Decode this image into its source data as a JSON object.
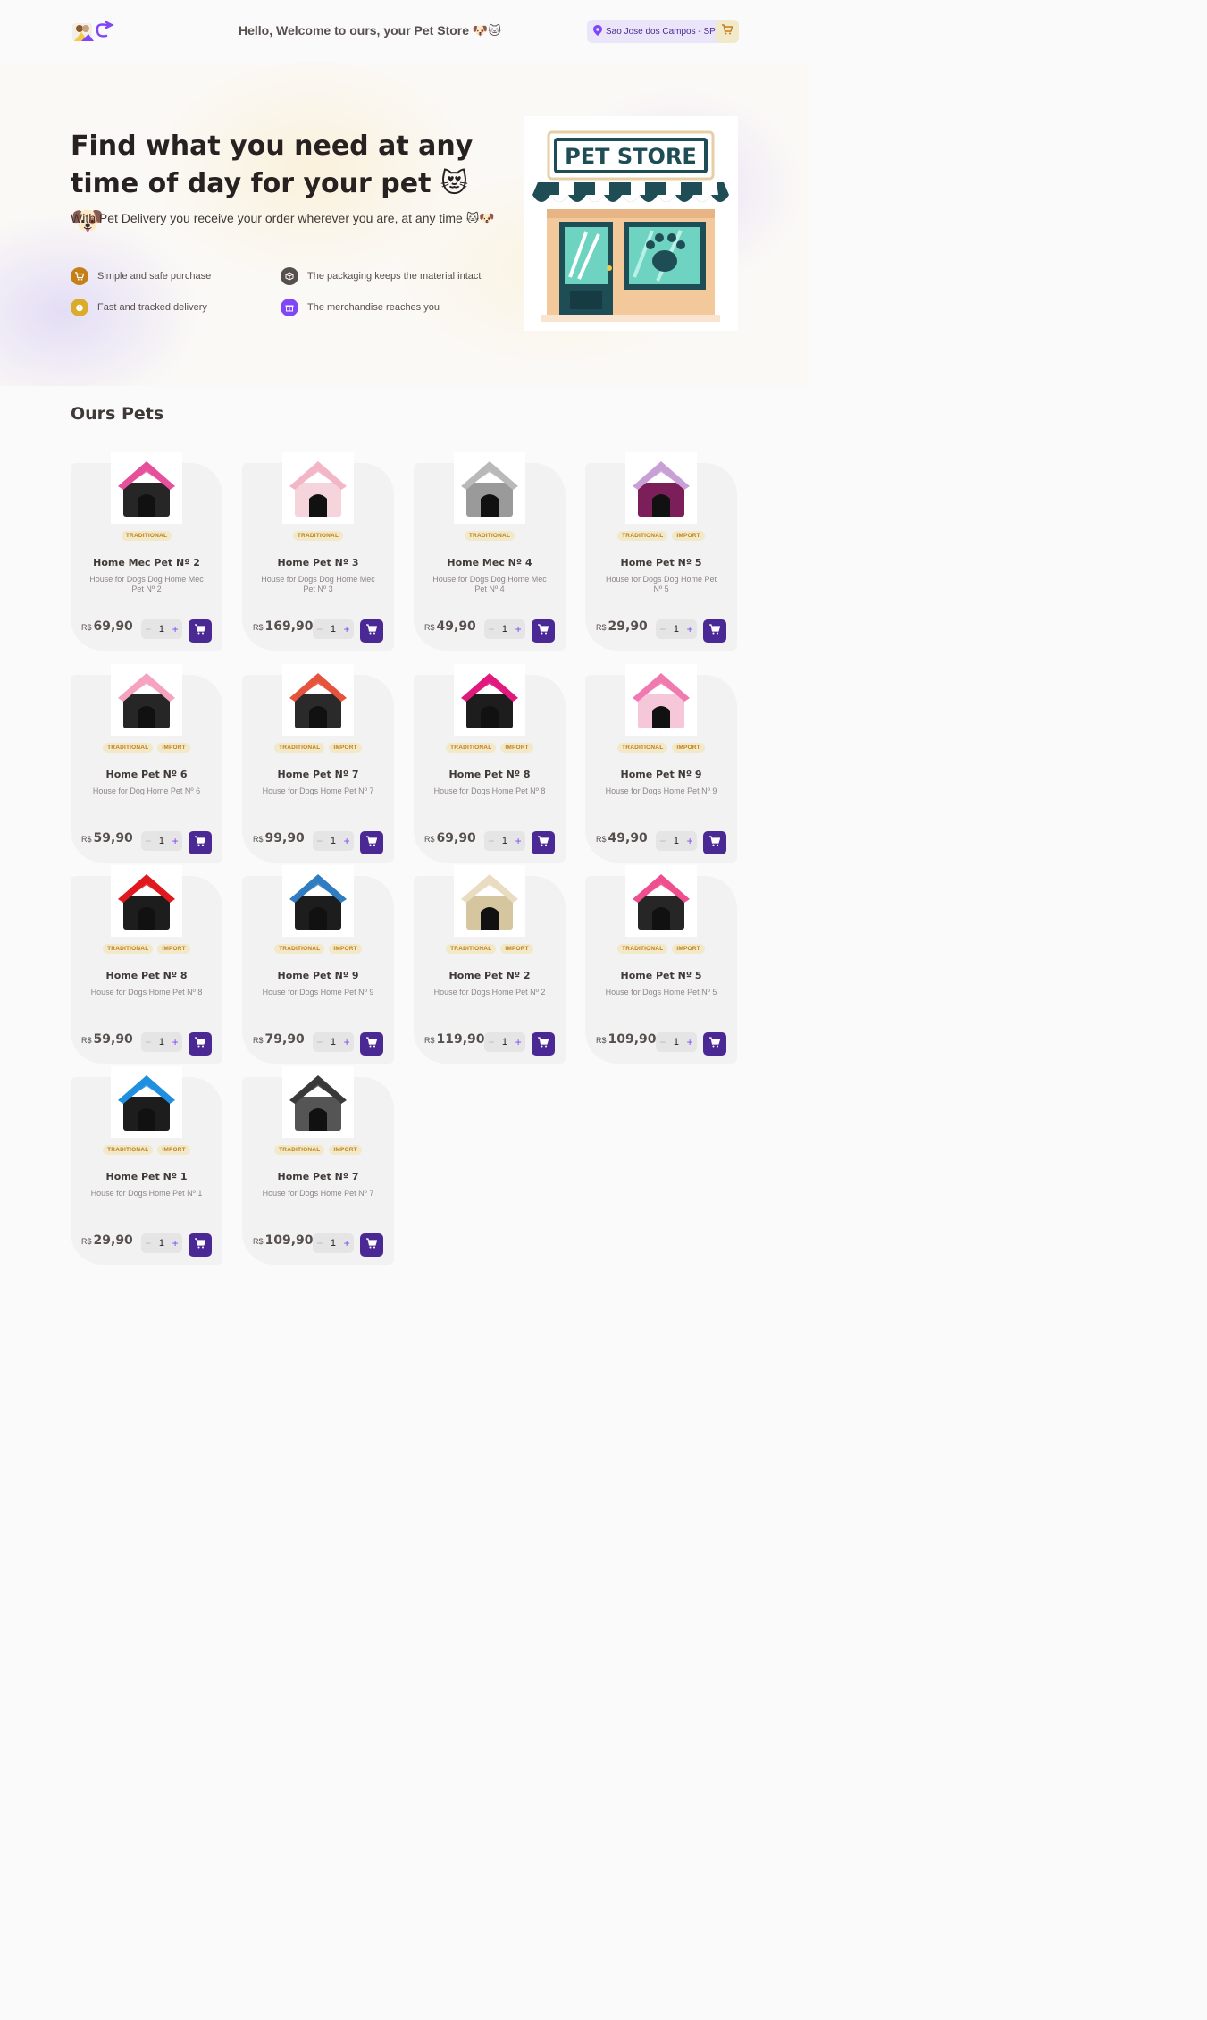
{
  "header": {
    "greeting": "Hello, Welcome to ours, your Pet Store 🐶🐱",
    "location": "Sao Jose dos Campos - SP"
  },
  "hero": {
    "title": "Find what you need at any time of day for your pet 😻🐶",
    "subtitle": "With Pet Delivery you receive your order wherever you are, at any time 🐱🐶",
    "features": [
      {
        "label": "Simple and safe purchase",
        "icon": "cart-icon",
        "color": "#c47f17"
      },
      {
        "label": "The packaging keeps the material intact",
        "icon": "package-icon",
        "color": "#574f4d"
      },
      {
        "label": "Fast and tracked delivery",
        "icon": "timer-icon",
        "color": "#dbac2c"
      },
      {
        "label": "The merchandise reaches you",
        "icon": "gift-icon",
        "color": "#8047f8"
      }
    ],
    "store_sign": "PET STORE"
  },
  "section": {
    "title": "Ours Pets"
  },
  "currency": "R$",
  "products": [
    {
      "title": "Home Mec Pet Nº 2",
      "desc": "House for Dogs Dog Home Mec Pet Nº 2",
      "price": "69,90",
      "qty": "1",
      "tags": [
        "TRADITIONAL"
      ],
      "roof": "#e6509a",
      "body": "#262626"
    },
    {
      "title": "Home Pet Nº 3",
      "desc": "House for Dogs Dog Home Mec Pet Nº 3",
      "price": "169,90",
      "qty": "1",
      "tags": [
        "TRADITIONAL"
      ],
      "roof": "#f2b6c6",
      "body": "#f6d4dc"
    },
    {
      "title": "Home Mec Nº 4",
      "desc": "House for Dogs Dog Home Mec Pet Nº 4",
      "price": "49,90",
      "qty": "1",
      "tags": [
        "TRADITIONAL"
      ],
      "roof": "#b9b9b9",
      "body": "#9a9a9a"
    },
    {
      "title": "Home Pet Nº 5",
      "desc": "House for Dogs Dog Home Pet Nº 5",
      "price": "29,90",
      "qty": "1",
      "tags": [
        "TRADITIONAL",
        "IMPORT"
      ],
      "roof": "#c9a0d6",
      "body": "#7b1e5a"
    },
    {
      "title": "Home Pet Nº 6",
      "desc": "House for Dog Home Pet Nº 6",
      "price": "59,90",
      "qty": "1",
      "tags": [
        "TRADITIONAL",
        "IMPORT"
      ],
      "roof": "#f5a3c0",
      "body": "#262626"
    },
    {
      "title": "Home Pet Nº 7",
      "desc": "House for Dogs Home Pet Nº 7",
      "price": "99,90",
      "qty": "1",
      "tags": [
        "TRADITIONAL",
        "IMPORT"
      ],
      "roof": "#e5533d",
      "body": "#2a2a2a"
    },
    {
      "title": "Home Pet Nº 8",
      "desc": "House for Dogs Home Pet Nº 8",
      "price": "69,90",
      "qty": "1",
      "tags": [
        "TRADITIONAL",
        "IMPORT"
      ],
      "roof": "#e0197d",
      "body": "#1d1d1d"
    },
    {
      "title": "Home Pet Nº 9",
      "desc": "House for Dogs Home Pet Nº 9",
      "price": "49,90",
      "qty": "1",
      "tags": [
        "TRADITIONAL",
        "IMPORT"
      ],
      "roof": "#f07ab0",
      "body": "#f6c6d9"
    },
    {
      "title": "Home Pet Nº 8",
      "desc": "House for Dogs Home Pet Nº 8",
      "price": "59,90",
      "qty": "1",
      "tags": [
        "TRADITIONAL",
        "IMPORT"
      ],
      "roof": "#e0191e",
      "body": "#1d1d1d"
    },
    {
      "title": "Home Pet Nº 9",
      "desc": "House for Dogs Home Pet Nº 9",
      "price": "79,90",
      "qty": "1",
      "tags": [
        "TRADITIONAL",
        "IMPORT"
      ],
      "roof": "#2f7cc1",
      "body": "#1d1d1d"
    },
    {
      "title": "Home Pet Nº 2",
      "desc": "House for Dogs Home Pet Nº 2",
      "price": "119,90",
      "qty": "1",
      "tags": [
        "TRADITIONAL",
        "IMPORT"
      ],
      "roof": "#e9dcc0",
      "body": "#d6c6a0"
    },
    {
      "title": "Home Pet Nº 5",
      "desc": "House for Dogs Home Pet Nº 5",
      "price": "109,90",
      "qty": "1",
      "tags": [
        "TRADITIONAL",
        "IMPORT"
      ],
      "roof": "#ef4f8f",
      "body": "#262626"
    },
    {
      "title": "Home Pet Nº 1",
      "desc": "House for Dogs Home Pet Nº 1",
      "price": "29,90",
      "qty": "1",
      "tags": [
        "TRADITIONAL",
        "IMPORT"
      ],
      "roof": "#1f8fe0",
      "body": "#1d1d1d"
    },
    {
      "title": "Home Pet Nº 7",
      "desc": "House for Dogs Home Pet Nº 7",
      "price": "109,90",
      "qty": "1",
      "tags": [
        "TRADITIONAL",
        "IMPORT"
      ],
      "roof": "#3a3a3a",
      "body": "#555555"
    }
  ],
  "colors": {
    "purple_dark": "#4b2995",
    "purple": "#8047f8",
    "yellow_dark": "#c47f17",
    "yellow_light": "#f1e9c9"
  }
}
